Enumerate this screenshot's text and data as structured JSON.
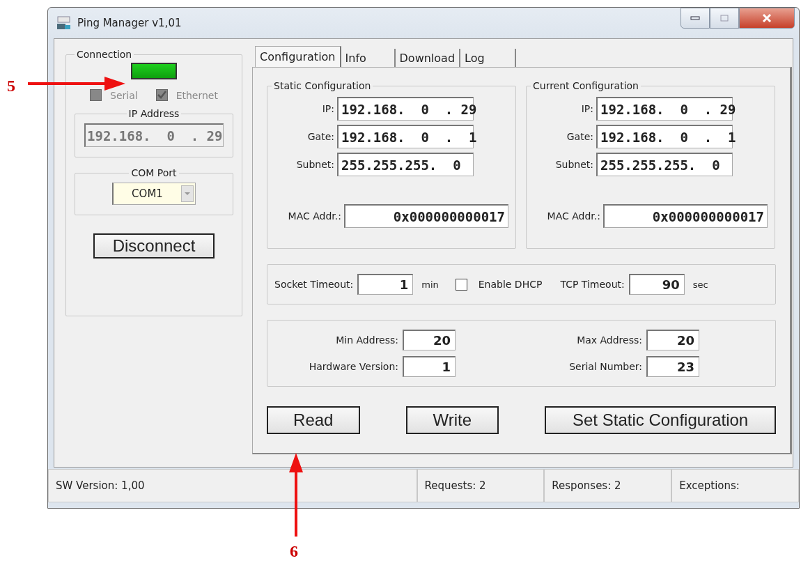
{
  "window": {
    "title": "Ping Manager v1,01"
  },
  "connection": {
    "title": "Connection",
    "connected": true,
    "serial": {
      "label": "Serial",
      "checked": false,
      "disabled": true
    },
    "ethernet": {
      "label": "Ethernet",
      "checked": true,
      "disabled": true
    },
    "ip_group": "IP Address",
    "ip_address": "192.168.  0  . 29",
    "com_group": "COM Port",
    "com_port": "COM1",
    "disconnect_button": "Disconnect"
  },
  "tabs": [
    {
      "label": "Configuration",
      "selected": true
    },
    {
      "label": "Info",
      "selected": false
    },
    {
      "label": "Download",
      "selected": false
    },
    {
      "label": "Log",
      "selected": false
    }
  ],
  "configs": [
    {
      "title": "Static Configuration",
      "fields": [
        {
          "label": "IP:",
          "value": "192.168.  0  . 29"
        },
        {
          "label": "Gate:",
          "value": "192.168.  0  .  1"
        },
        {
          "label": "Subnet:",
          "value": "255.255.255.  0"
        }
      ],
      "mac_label": "MAC Addr.:",
      "mac": "0x000000000017"
    },
    {
      "title": "Current Configuration",
      "fields": [
        {
          "label": "IP:",
          "value": "192.168.  0  . 29"
        },
        {
          "label": "Gate:",
          "value": "192.168.  0  .  1"
        },
        {
          "label": "Subnet:",
          "value": "255.255.255.  0"
        }
      ],
      "mac_label": "MAC Addr.:",
      "mac": "0x000000000017"
    }
  ],
  "timeouts": {
    "socket_label": "Socket Timeout:",
    "socket_value": "1",
    "socket_unit": "min",
    "dhcp": {
      "label": "Enable DHCP",
      "checked": false
    },
    "tcp_label": "TCP Timeout:",
    "tcp_value": "90",
    "tcp_unit": "sec"
  },
  "device": [
    {
      "label": "Min Address:",
      "value": "20"
    },
    {
      "label": "Max Address:",
      "value": "20"
    },
    {
      "label": "Hardware Version:",
      "value": "1"
    },
    {
      "label": "Serial Number:",
      "value": "23"
    }
  ],
  "buttons": [
    "Read",
    "Write",
    "Set Static Configuration"
  ],
  "status_bar": [
    "SW Version: 1,00",
    "Requests: 2",
    "Responses: 2",
    "Exceptions:"
  ],
  "callouts": [
    {
      "label": "5"
    },
    {
      "label": "6"
    }
  ]
}
